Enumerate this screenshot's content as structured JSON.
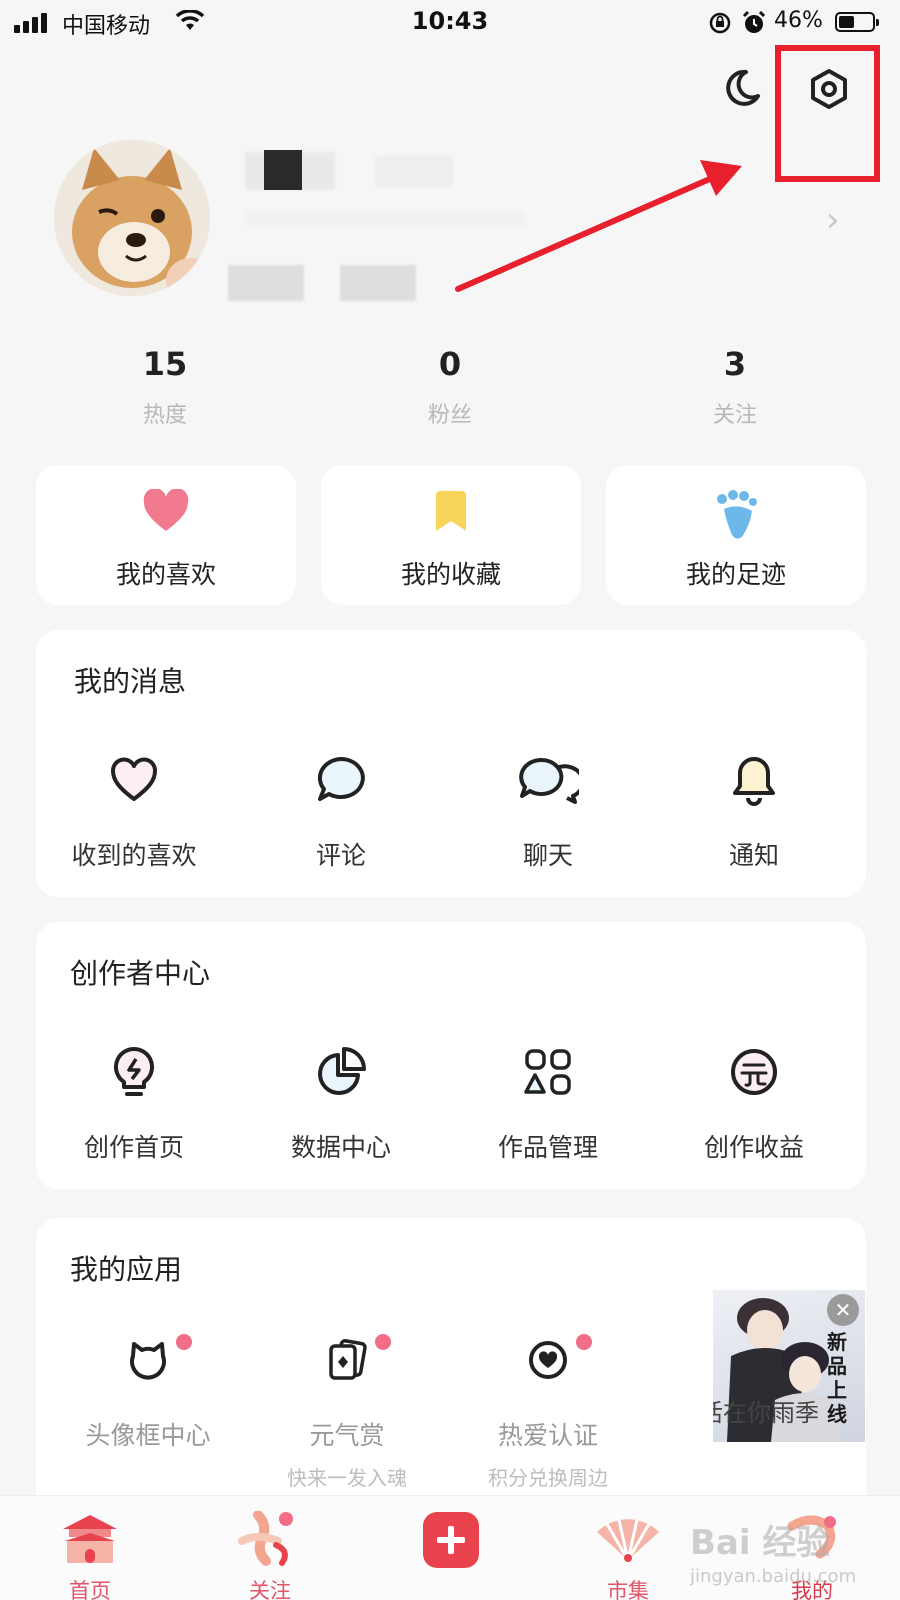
{
  "status_bar": {
    "carrier": "中国移动",
    "time": "10:43",
    "battery": "46%",
    "battery_level": 0.46
  },
  "stats": [
    {
      "value": "15",
      "label": "热度"
    },
    {
      "value": "0",
      "label": "粉丝"
    },
    {
      "value": "3",
      "label": "关注"
    }
  ],
  "quick": [
    {
      "label": "我的喜欢",
      "icon": "heart-icon"
    },
    {
      "label": "我的收藏",
      "icon": "bookmark-icon"
    },
    {
      "label": "我的足迹",
      "icon": "footprint-icon"
    }
  ],
  "messages": {
    "title": "我的消息",
    "items": [
      {
        "label": "收到的喜欢",
        "icon": "heart-outline-icon"
      },
      {
        "label": "评论",
        "icon": "comment-icon"
      },
      {
        "label": "聊天",
        "icon": "chat-icon"
      },
      {
        "label": "通知",
        "icon": "bell-icon"
      }
    ]
  },
  "creator": {
    "title": "创作者中心",
    "items": [
      {
        "label": "创作首页",
        "icon": "lightbulb-icon"
      },
      {
        "label": "数据中心",
        "icon": "pie-chart-icon"
      },
      {
        "label": "作品管理",
        "icon": "shapes-icon"
      },
      {
        "label": "创作收益",
        "icon": "yuan-icon"
      }
    ]
  },
  "apps": {
    "title": "我的应用",
    "items": [
      {
        "label": "头像框中心",
        "sub": "",
        "icon": "cat-frame-icon"
      },
      {
        "label": "元气赏",
        "sub": "快来一发入魂",
        "icon": "cards-icon"
      },
      {
        "label": "热爱认证",
        "sub": "积分兑换周边",
        "icon": "heart-badge-icon"
      }
    ]
  },
  "promo": {
    "vertical_text": "新品上线",
    "caption": "活在你雨季"
  },
  "tabs": [
    {
      "label": "首页",
      "icon": "palace-icon"
    },
    {
      "label": "关注",
      "icon": "follow-icon"
    },
    {
      "label": "市集",
      "icon": "fan-icon"
    },
    {
      "label": "我的",
      "icon": "profile-icon"
    }
  ],
  "watermark": {
    "brand": "Bai 经验",
    "url": "jingyan.baidu.com"
  },
  "colors": {
    "accent": "#e8424c",
    "highlight": "#e8202e",
    "tab_text": "#e05569",
    "heart": "#f27a8e",
    "bookmark": "#f7d55a",
    "footprint": "#6cb8e8"
  }
}
